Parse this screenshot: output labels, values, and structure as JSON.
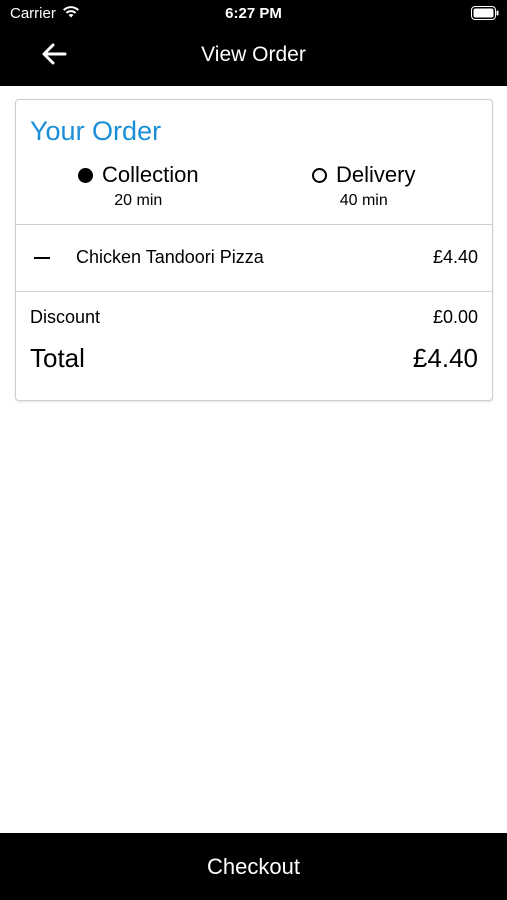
{
  "status_bar": {
    "carrier": "Carrier",
    "time": "6:27 PM",
    "wifi_icon": "wifi-icon",
    "battery_icon": "battery-icon"
  },
  "nav": {
    "back_icon": "arrow-left-icon",
    "title": "View Order"
  },
  "order": {
    "title": "Your Order",
    "title_color": "#1a8fd6",
    "modes": [
      {
        "label": "Collection",
        "time": "20 min",
        "selected": true
      },
      {
        "label": "Delivery",
        "time": "40 min",
        "selected": false
      }
    ],
    "items": [
      {
        "name": "Chicken Tandoori Pizza",
        "price": "£4.40",
        "remove_icon": "minus-icon"
      }
    ],
    "discount_label": "Discount",
    "discount_value": "£0.00",
    "total_label": "Total",
    "total_value": "£4.40"
  },
  "checkout": {
    "label": "Checkout"
  }
}
